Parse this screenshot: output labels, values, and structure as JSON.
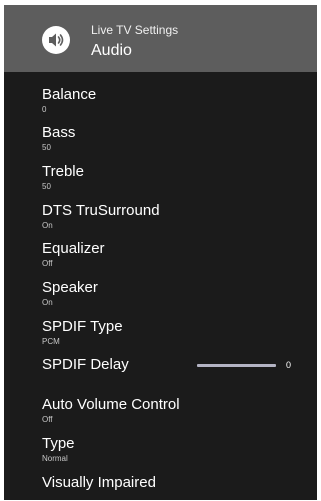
{
  "header": {
    "subtitle": "Live TV Settings",
    "title": "Audio",
    "icon": "speaker-volume-icon"
  },
  "menu": {
    "items": [
      {
        "label": "Balance",
        "value": "0"
      },
      {
        "label": "Bass",
        "value": "50"
      },
      {
        "label": "Treble",
        "value": "50"
      },
      {
        "label": "DTS TruSurround",
        "value": "On"
      },
      {
        "label": "Equalizer",
        "value": "Off"
      },
      {
        "label": "Speaker",
        "value": "On"
      },
      {
        "label": "SPDIF Type",
        "value": "PCM"
      },
      {
        "label": "SPDIF Delay",
        "value": "0",
        "slider_level": 0
      },
      {
        "label": "Auto Volume Control",
        "value": "Off"
      },
      {
        "label": "Type",
        "value": "Normal"
      },
      {
        "label": "Visually Impaired"
      }
    ]
  }
}
